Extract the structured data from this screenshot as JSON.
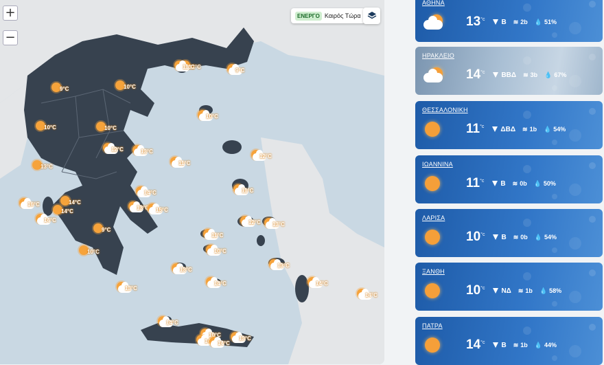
{
  "map": {
    "zoom_in": "+",
    "zoom_out": "−",
    "live_badge": "ΕΝΕΡΓΟ",
    "live_label": "Καιρός Τώρα",
    "markers": [
      {
        "t": "12°C",
        "c": false
      },
      {
        "t": "11°C",
        "c": true
      },
      {
        "t": "9°C",
        "c": true
      },
      {
        "t": "9°C",
        "c": false
      },
      {
        "t": "10°C",
        "c": false
      },
      {
        "t": "10°C",
        "c": false
      },
      {
        "t": "10°C",
        "c": false
      },
      {
        "t": "10°C",
        "c": true
      },
      {
        "t": "12°C",
        "c": true
      },
      {
        "t": "13°C",
        "c": true
      },
      {
        "t": "11°C",
        "c": true
      },
      {
        "t": "12°C",
        "c": true
      },
      {
        "t": "13°C",
        "c": false
      },
      {
        "t": "11°C",
        "c": true
      },
      {
        "t": "16°C",
        "c": true
      },
      {
        "t": "14°C",
        "c": false
      },
      {
        "t": "14°C",
        "c": false
      },
      {
        "t": "14°C",
        "c": true
      },
      {
        "t": "14°C",
        "c": true
      },
      {
        "t": "13°C",
        "c": true
      },
      {
        "t": "15°C",
        "c": true
      },
      {
        "t": "12°C",
        "c": true
      },
      {
        "t": "13°C",
        "c": true
      },
      {
        "t": "9°C",
        "c": false
      },
      {
        "t": "11°C",
        "c": true
      },
      {
        "t": "10°C",
        "c": true
      },
      {
        "t": "10°C",
        "c": false
      },
      {
        "t": "13°C",
        "c": true
      },
      {
        "t": "13°C",
        "c": true
      },
      {
        "t": "14°C",
        "c": true
      },
      {
        "t": "14°C",
        "c": true
      },
      {
        "t": "13°C",
        "c": true
      },
      {
        "t": "14°C",
        "c": true
      },
      {
        "t": "14°C",
        "c": true
      },
      {
        "t": "10°C",
        "c": true
      },
      {
        "t": "14°C",
        "c": true
      },
      {
        "t": "13°C",
        "c": true
      },
      {
        "t": "14°C",
        "c": true
      }
    ]
  },
  "cities": [
    {
      "name": "ΑΘΗΝΑ",
      "temp": "13",
      "unit": "°c",
      "dir": "Β",
      "beaufort": "2b",
      "humidity": "51%",
      "cloudy": false,
      "icon": "cloud-sun"
    },
    {
      "name": "ΗΡΑΚΛΕΙΟ",
      "temp": "14",
      "unit": "°c",
      "dir": "ΒΒΔ",
      "beaufort": "3b",
      "humidity": "67%",
      "cloudy": true,
      "icon": "cloud-sun"
    },
    {
      "name": "ΘΕΣΣΑΛΟΝΙΚΗ",
      "temp": "11",
      "unit": "°c",
      "dir": "ΔΒΔ",
      "beaufort": "1b",
      "humidity": "54%",
      "cloudy": false,
      "icon": "sun"
    },
    {
      "name": "ΙΩΑΝΝΙΝΑ",
      "temp": "11",
      "unit": "°c",
      "dir": "Β",
      "beaufort": "0b",
      "humidity": "50%",
      "cloudy": false,
      "icon": "sun"
    },
    {
      "name": "ΛΑΡΙΣΑ",
      "temp": "10",
      "unit": "°c",
      "dir": "Β",
      "beaufort": "0b",
      "humidity": "54%",
      "cloudy": false,
      "icon": "sun"
    },
    {
      "name": "ΞΑΝΘΗ",
      "temp": "10",
      "unit": "°c",
      "dir": "ΝΔ",
      "beaufort": "1b",
      "humidity": "58%",
      "cloudy": false,
      "icon": "sun"
    },
    {
      "name": "ΠΑΤΡΑ",
      "temp": "14",
      "unit": "°c",
      "dir": "Β",
      "beaufort": "1b",
      "humidity": "44%",
      "cloudy": false,
      "icon": "sun"
    }
  ]
}
